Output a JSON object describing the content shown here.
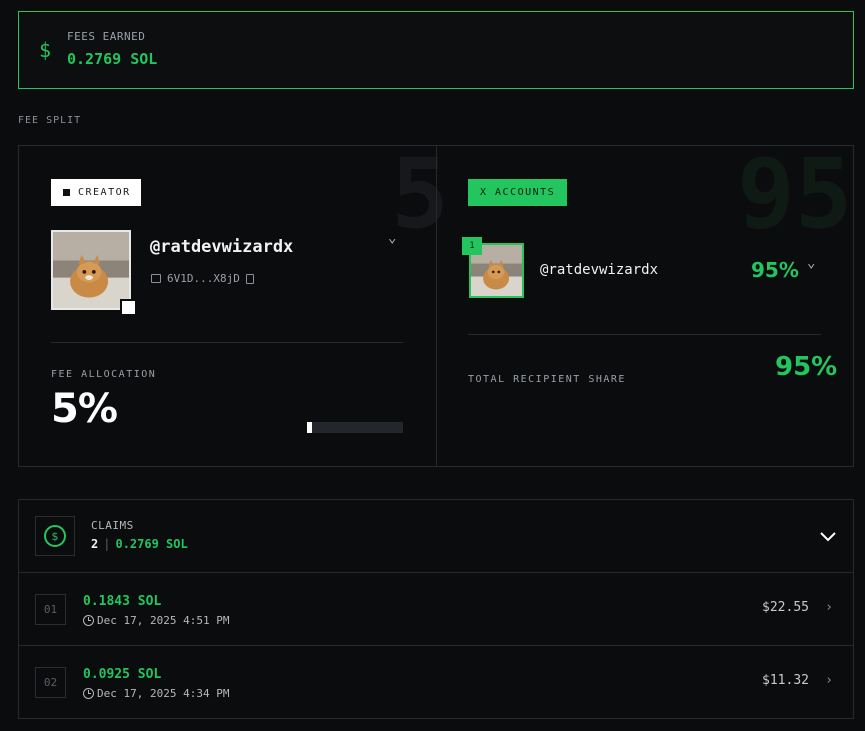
{
  "fees": {
    "icon": "dollar-icon",
    "label": "FEES EARNED",
    "value": "0.2769 SOL"
  },
  "fee_split": {
    "label": "FEE SPLIT",
    "creator": {
      "bg_number": "5",
      "badge": "CREATOR",
      "handle": "@ratdevwizardx",
      "address": "6V1D...X8jD",
      "allocation_label": "FEE ALLOCATION",
      "allocation_value": "5%",
      "allocation_fraction": 0.05
    },
    "x_accounts": {
      "bg_number": "95",
      "badge": "X ACCOUNTS",
      "items": [
        {
          "index": "1",
          "handle": "@ratdevwizardx",
          "percent": "95%"
        }
      ],
      "total_label": "TOTAL RECIPIENT SHARE",
      "total_value": "95%"
    }
  },
  "claims": {
    "title": "CLAIMS",
    "count": "2",
    "total": "0.2769 SOL",
    "rows": [
      {
        "index": "01",
        "amount": "0.1843 SOL",
        "time": "Dec 17, 2025 4:51 PM",
        "usd": "$22.55"
      },
      {
        "index": "02",
        "amount": "0.0925 SOL",
        "time": "Dec 17, 2025 4:34 PM",
        "usd": "$11.32"
      }
    ]
  },
  "colors": {
    "accent": "#22c55e",
    "background": "#0b0c0e",
    "border": "#26292d"
  }
}
